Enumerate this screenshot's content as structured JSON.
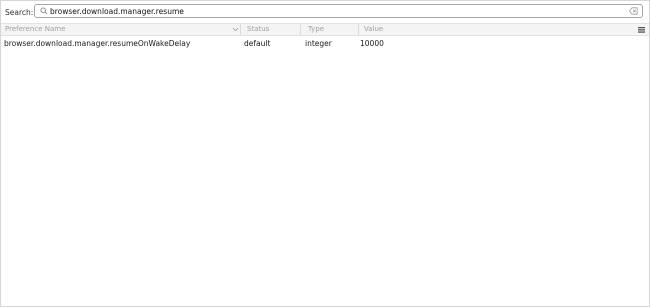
{
  "search": {
    "label": "Search:",
    "value": "browser.download.manager.resume",
    "search_icon": "search-icon",
    "clear_icon": "clear-icon"
  },
  "table": {
    "columns": [
      "Preference Name",
      "Status",
      "Type",
      "Value"
    ],
    "sort_icon": "chevron-down-icon",
    "column_picker_icon": "column-picker-icon",
    "rows": [
      {
        "name": "browser.download.manager.resumeOnWakeDelay",
        "status": "default",
        "type": "integer",
        "value": "10000"
      }
    ]
  }
}
